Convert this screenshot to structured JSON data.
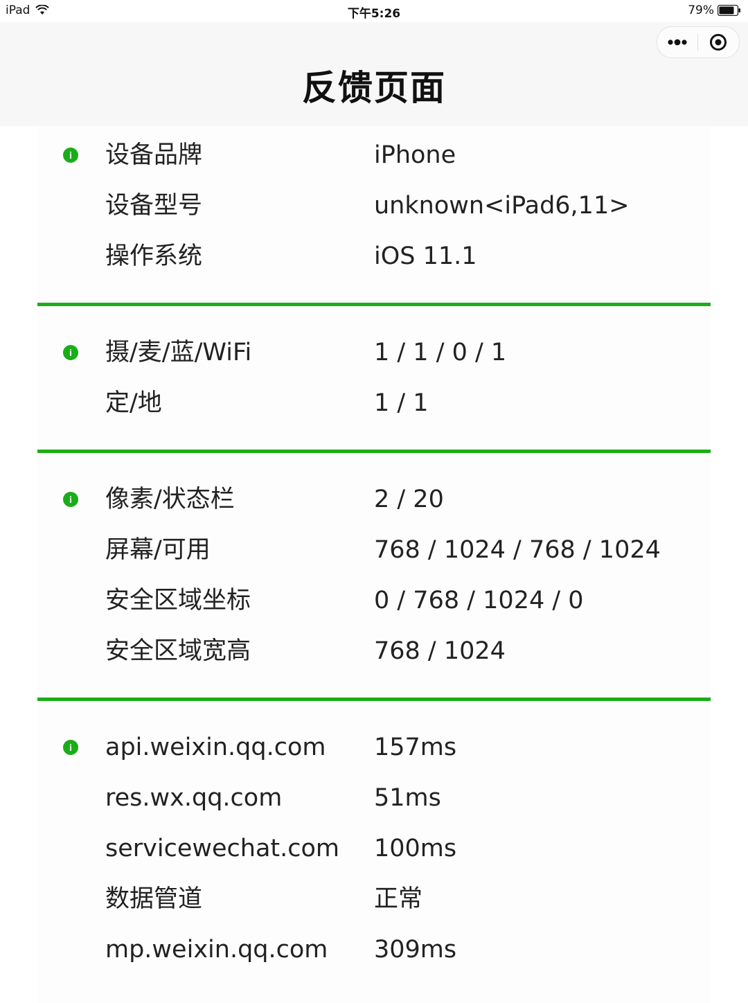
{
  "status_bar": {
    "device": "iPad",
    "time": "下午5:26",
    "battery": "79%",
    "icons": [
      "wifi-icon",
      "battery-icon"
    ]
  },
  "header": {
    "title": "反馈页面",
    "capsule_icons": [
      "more-dots-icon",
      "close-target-icon"
    ]
  },
  "sections": [
    {
      "rows": [
        {
          "label": "设备品牌",
          "value": "iPhone"
        },
        {
          "label": "设备型号",
          "value": "unknown<iPad6,11>"
        },
        {
          "label": "操作系统",
          "value": "iOS 11.1"
        }
      ]
    },
    {
      "rows": [
        {
          "label": "摄/麦/蓝/WiFi",
          "value": "1 / 1 / 0 / 1"
        },
        {
          "label": "定/地",
          "value": "1 / 1"
        }
      ]
    },
    {
      "rows": [
        {
          "label": "像素/状态栏",
          "value": "2  /  20"
        },
        {
          "label": "屏幕/可用",
          "value": "768  /  1024  /  768  /  1024"
        },
        {
          "label": "安全区域坐标",
          "value": "0  /  768  /  1024  /  0"
        },
        {
          "label": "安全区域宽高",
          "value": "768  /  1024"
        }
      ]
    },
    {
      "rows": [
        {
          "label": "api.weixin.qq.com",
          "value": "157ms"
        },
        {
          "label": "res.wx.qq.com",
          "value": "51ms"
        },
        {
          "label": "servicewechat.com",
          "value": "100ms"
        },
        {
          "label": "数据管道",
          "value": "正常"
        },
        {
          "label": "mp.weixin.qq.com",
          "value": "309ms"
        }
      ]
    }
  ],
  "colors": {
    "accent": "#1aad19",
    "header_bg": "#f7f7f7",
    "text": "#222222"
  }
}
